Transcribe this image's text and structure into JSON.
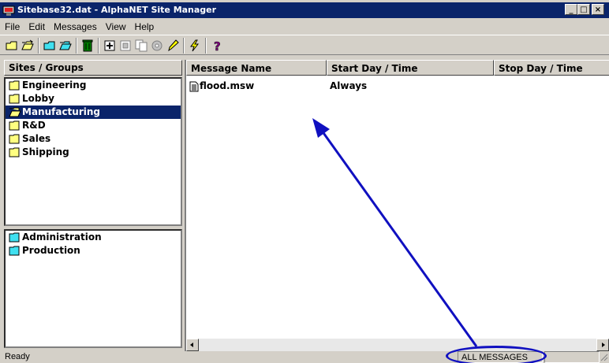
{
  "window": {
    "title": "Sitebase32.dat - AlphaNET Site Manager",
    "controls": [
      "_",
      "□",
      "×"
    ]
  },
  "menu": [
    "File",
    "Edit",
    "Messages",
    "View",
    "Help"
  ],
  "toolbar_icons": [
    "new-folder-icon",
    "open-folder-icon",
    "folder-icon",
    "open-folder-icon",
    "trash-icon",
    "add-icon",
    "copy-icon",
    "duplicate-icon",
    "properties-icon",
    "pencil-icon",
    "lightning-icon",
    "help-icon"
  ],
  "left_pane": {
    "header": "Sites / Groups",
    "sites": [
      {
        "label": "Engineering",
        "selected": false
      },
      {
        "label": "Lobby",
        "selected": false
      },
      {
        "label": "Manufacturing",
        "selected": true
      },
      {
        "label": "R&D",
        "selected": false
      },
      {
        "label": "Sales",
        "selected": false
      },
      {
        "label": "Shipping",
        "selected": false
      }
    ],
    "groups": [
      {
        "label": "Administration"
      },
      {
        "label": "Production"
      }
    ]
  },
  "messages": {
    "columns": [
      "Message Name",
      "Start Day / Time",
      "Stop Day / Time"
    ],
    "rows": [
      {
        "name": "flood.msw",
        "start": "Always",
        "stop": ""
      }
    ]
  },
  "status": {
    "text": "Ready",
    "filter": "ALL MESSAGES"
  },
  "colors": {
    "title_bg": "#0a246a",
    "selection": "#0a246a",
    "annotation": "#1010c0",
    "folder_yellow": "#ffff80",
    "folder_cyan": "#40e0f0"
  }
}
